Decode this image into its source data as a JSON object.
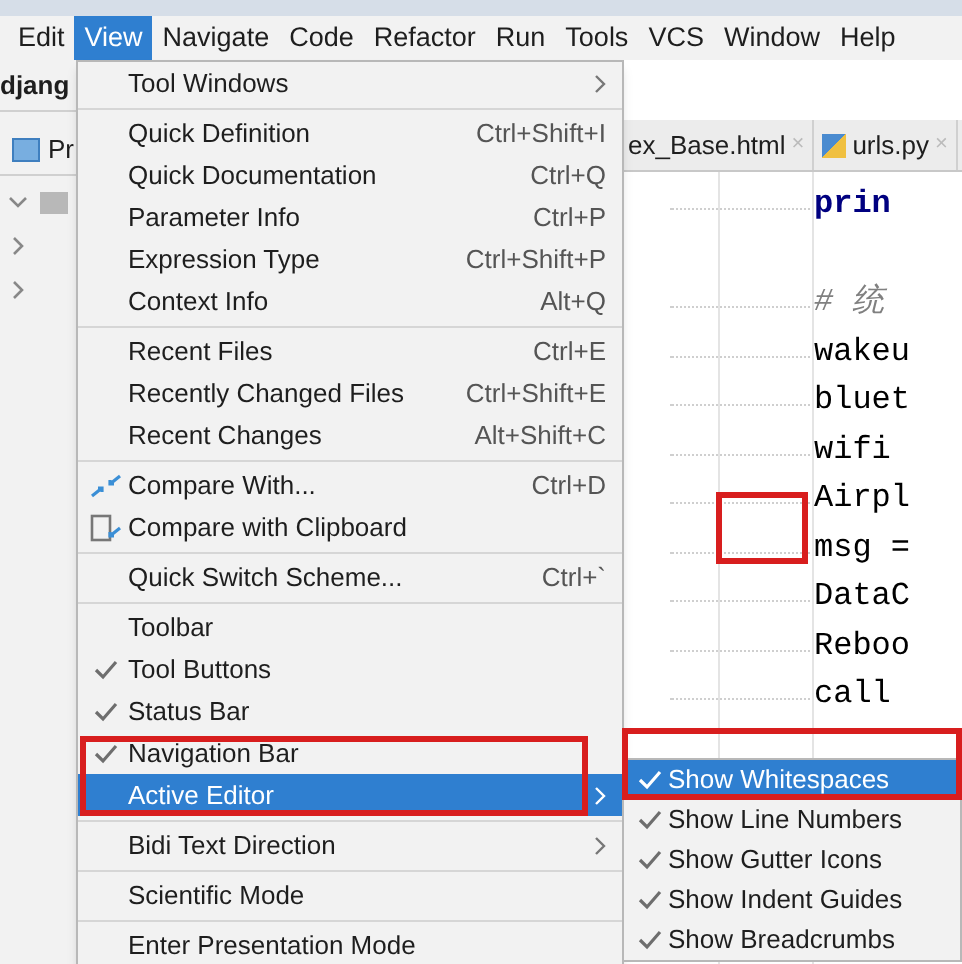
{
  "menu_bar": [
    {
      "label": "Edit",
      "selected": false
    },
    {
      "label": "View",
      "selected": true
    },
    {
      "label": "Navigate",
      "selected": false
    },
    {
      "label": "Code",
      "selected": false
    },
    {
      "label": "Refactor",
      "selected": false
    },
    {
      "label": "Run",
      "selected": false
    },
    {
      "label": "Tools",
      "selected": false
    },
    {
      "label": "VCS",
      "selected": false
    },
    {
      "label": "Window",
      "selected": false
    },
    {
      "label": "Help",
      "selected": false
    }
  ],
  "project_bar": {
    "title": "djang"
  },
  "tool_window_tab": {
    "label": "Pr"
  },
  "project_tree": [
    {
      "expanded": true
    },
    {
      "expanded": false
    },
    {
      "expanded": false
    }
  ],
  "editor_tabs": [
    {
      "label": "ex_Base.html",
      "kind": "html",
      "close": "×"
    },
    {
      "label": "urls.py",
      "kind": "python",
      "close": "×"
    }
  ],
  "code_lines": [
    {
      "text": "prin",
      "kind": "keyword"
    },
    {
      "kind": "blank"
    },
    {
      "text": "# 统",
      "kind": "comment"
    },
    {
      "text": "wakeu",
      "kind": "code"
    },
    {
      "text": "bluet",
      "kind": "code"
    },
    {
      "text": "wifi",
      "kind": "code"
    },
    {
      "text": "Airpl",
      "kind": "code"
    },
    {
      "text": "msg =",
      "kind": "code"
    },
    {
      "text": "DataC",
      "kind": "code"
    },
    {
      "text": "Reboo",
      "kind": "code"
    },
    {
      "text": "call",
      "kind": "code"
    }
  ],
  "view_menu": [
    {
      "kind": "item",
      "label": "Tool Windows",
      "submenu": true,
      "selected": false,
      "checked": false
    },
    {
      "kind": "separator"
    },
    {
      "kind": "item",
      "label": "Quick Definition",
      "shortcut": "Ctrl+Shift+I",
      "selected": false,
      "checked": false
    },
    {
      "kind": "item",
      "label": "Quick Documentation",
      "shortcut": "Ctrl+Q",
      "selected": false,
      "checked": false
    },
    {
      "kind": "item",
      "label": "Parameter Info",
      "shortcut": "Ctrl+P",
      "selected": false,
      "checked": false
    },
    {
      "kind": "item",
      "label": "Expression Type",
      "shortcut": "Ctrl+Shift+P",
      "selected": false,
      "checked": false
    },
    {
      "kind": "item",
      "label": "Context Info",
      "shortcut": "Alt+Q",
      "selected": false,
      "checked": false
    },
    {
      "kind": "separator"
    },
    {
      "kind": "item",
      "label": "Recent Files",
      "shortcut": "Ctrl+E",
      "selected": false,
      "checked": false
    },
    {
      "kind": "item",
      "label": "Recently Changed Files",
      "shortcut": "Ctrl+Shift+E",
      "selected": false,
      "checked": false
    },
    {
      "kind": "item",
      "label": "Recent Changes",
      "shortcut": "Alt+Shift+C",
      "selected": false,
      "checked": false
    },
    {
      "kind": "separator"
    },
    {
      "kind": "compare-item",
      "label": "Compare With...",
      "shortcut": "Ctrl+D",
      "selected": false,
      "checked": false
    },
    {
      "kind": "clipboard-item",
      "label": "Compare with Clipboard",
      "selected": false,
      "checked": false
    },
    {
      "kind": "separator"
    },
    {
      "kind": "item",
      "label": "Quick Switch Scheme...",
      "shortcut": "Ctrl+`",
      "selected": false,
      "checked": false
    },
    {
      "kind": "separator"
    },
    {
      "kind": "item",
      "label": "Toolbar",
      "selected": false,
      "checked": false
    },
    {
      "kind": "item",
      "label": "Tool Buttons",
      "selected": false,
      "checked": true
    },
    {
      "kind": "item",
      "label": "Status Bar",
      "selected": false,
      "checked": true
    },
    {
      "kind": "item",
      "label": "Navigation Bar",
      "selected": false,
      "checked": true
    },
    {
      "kind": "item",
      "label": "Active Editor",
      "submenu": true,
      "selected": true,
      "checked": false
    },
    {
      "kind": "separator"
    },
    {
      "kind": "item",
      "label": "Bidi Text Direction",
      "submenu": true,
      "selected": false,
      "checked": false
    },
    {
      "kind": "separator"
    },
    {
      "kind": "item",
      "label": "Scientific Mode",
      "selected": false,
      "checked": false
    },
    {
      "kind": "separator"
    },
    {
      "kind": "item",
      "label": "Enter Presentation Mode",
      "selected": false,
      "checked": false
    }
  ],
  "active_editor_submenu": [
    {
      "label": "Show Whitespaces",
      "checked": true,
      "selected": true
    },
    {
      "label": "Show Line Numbers",
      "checked": true,
      "selected": false
    },
    {
      "label": "Show Gutter Icons",
      "checked": true,
      "selected": false
    },
    {
      "label": "Show Indent Guides",
      "checked": true,
      "selected": false
    },
    {
      "label": "Show Breadcrumbs",
      "checked": true,
      "selected": false
    }
  ]
}
